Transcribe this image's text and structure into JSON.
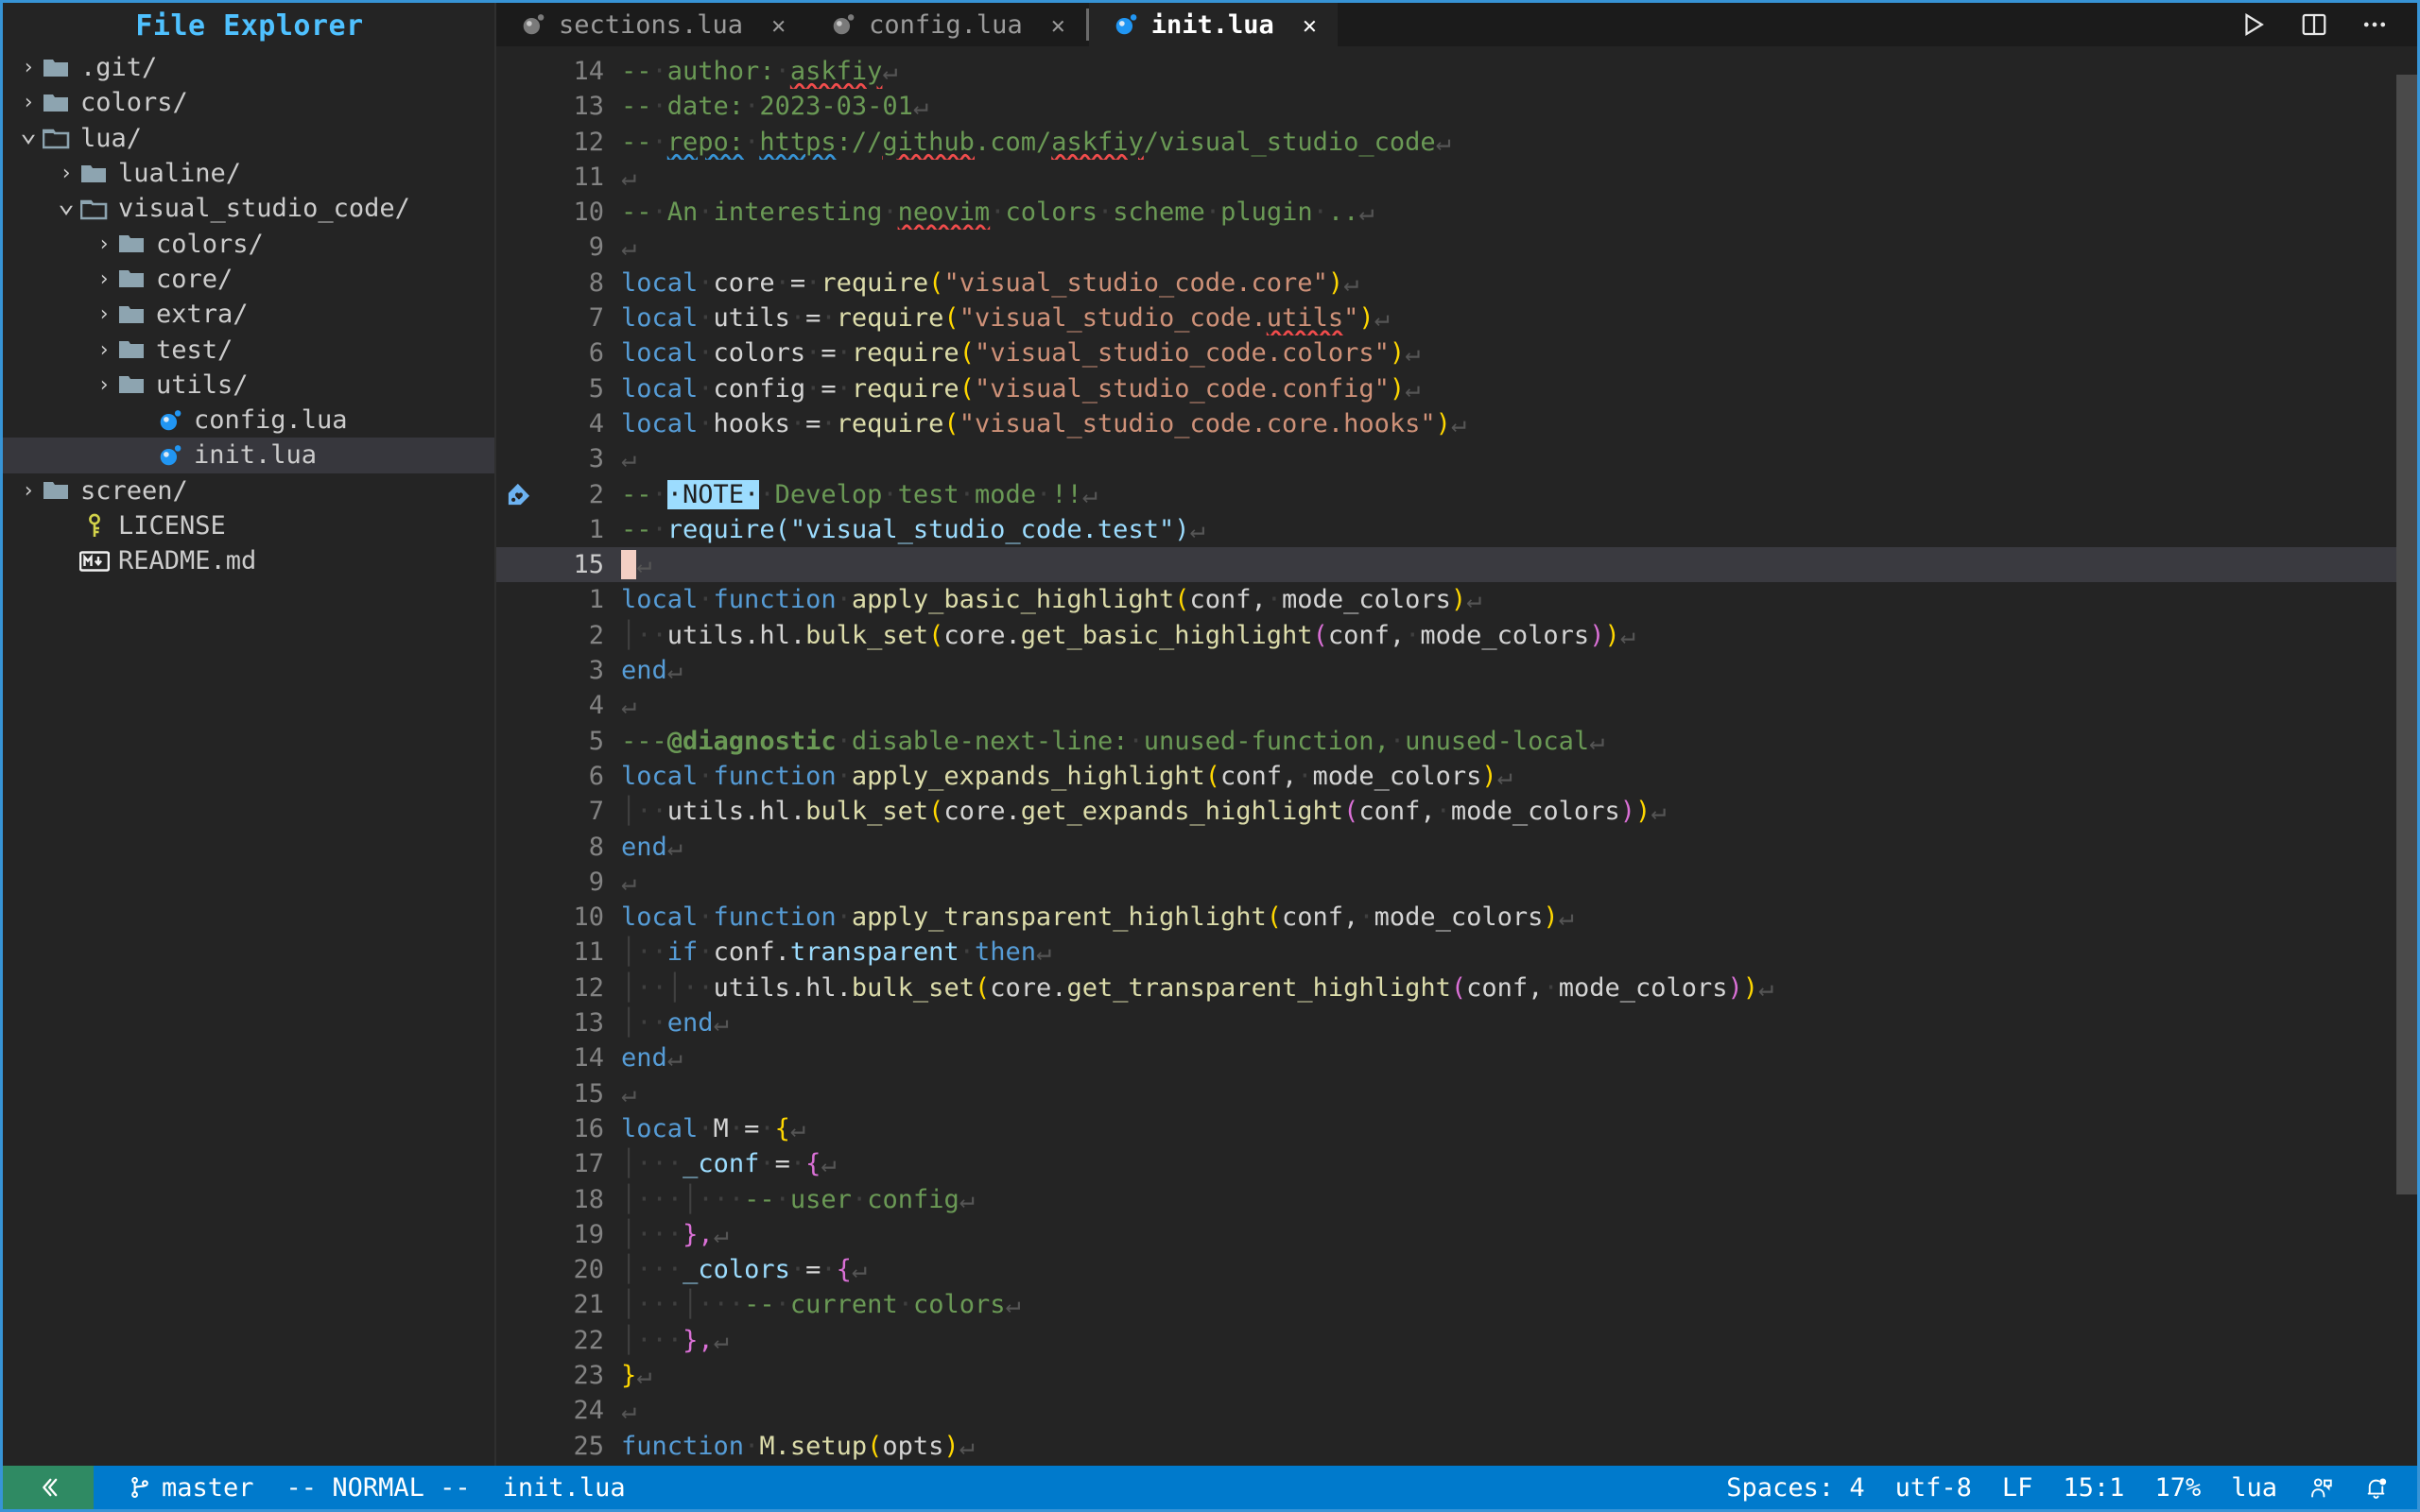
{
  "window": {
    "accent_border": "#3794d6",
    "editor_bg": "#242424",
    "tabbar_bg": "#1b1b1b"
  },
  "sidebar": {
    "title": "File Explorer",
    "items": [
      {
        "label": ".git/",
        "type": "folder",
        "state": "collapsed",
        "depth": 0,
        "icon": "folder-icon",
        "selected": false
      },
      {
        "label": "colors/",
        "type": "folder",
        "state": "collapsed",
        "depth": 0,
        "icon": "folder-icon",
        "selected": false
      },
      {
        "label": "lua/",
        "type": "folder",
        "state": "expanded",
        "depth": 0,
        "icon": "folder-open-icon",
        "selected": false
      },
      {
        "label": "lualine/",
        "type": "folder",
        "state": "collapsed",
        "depth": 1,
        "icon": "folder-icon",
        "selected": false
      },
      {
        "label": "visual_studio_code/",
        "type": "folder",
        "state": "expanded",
        "depth": 1,
        "icon": "folder-open-icon",
        "selected": false
      },
      {
        "label": "colors/",
        "type": "folder",
        "state": "collapsed",
        "depth": 2,
        "icon": "folder-icon",
        "selected": false
      },
      {
        "label": "core/",
        "type": "folder",
        "state": "collapsed",
        "depth": 2,
        "icon": "folder-icon",
        "selected": false
      },
      {
        "label": "extra/",
        "type": "folder",
        "state": "collapsed",
        "depth": 2,
        "icon": "folder-icon",
        "selected": false
      },
      {
        "label": "test/",
        "type": "folder",
        "state": "collapsed",
        "depth": 2,
        "icon": "folder-icon",
        "selected": false
      },
      {
        "label": "utils/",
        "type": "folder",
        "state": "collapsed",
        "depth": 2,
        "icon": "folder-icon",
        "selected": false
      },
      {
        "label": "config.lua",
        "type": "file",
        "state": "none",
        "depth": 3,
        "icon": "lua-file-icon",
        "selected": false
      },
      {
        "label": "init.lua",
        "type": "file",
        "state": "none",
        "depth": 3,
        "icon": "lua-file-icon",
        "selected": true
      },
      {
        "label": "screen/",
        "type": "folder",
        "state": "collapsed",
        "depth": 0,
        "icon": "folder-icon",
        "selected": false
      },
      {
        "label": "LICENSE",
        "type": "file",
        "state": "none",
        "depth": 1,
        "icon": "license-key-icon",
        "selected": false
      },
      {
        "label": "README.md",
        "type": "file",
        "state": "none",
        "depth": 1,
        "icon": "markdown-icon",
        "selected": false
      }
    ]
  },
  "tabs": {
    "items": [
      {
        "label": "sections.lua",
        "icon": "lua-file-icon",
        "close": "✕",
        "active": false
      },
      {
        "label": "config.lua",
        "icon": "lua-file-icon",
        "close": "✕",
        "active": false
      },
      {
        "label": "init.lua",
        "icon": "lua-file-icon",
        "close": "✕",
        "active": true
      }
    ],
    "actions": [
      {
        "name": "run-icon",
        "glyph": "▷"
      },
      {
        "name": "split-editor-icon",
        "glyph": "▫"
      },
      {
        "name": "more-actions-icon",
        "glyph": "⋯"
      }
    ]
  },
  "editor": {
    "filename": "init.lua",
    "language": "lua",
    "cursor_line": 15,
    "lines": [
      {
        "num": "14",
        "type": "rel",
        "sign": null,
        "cursor": false
      },
      {
        "num": "13",
        "type": "rel",
        "sign": null,
        "cursor": false
      },
      {
        "num": "12",
        "type": "rel",
        "sign": null,
        "cursor": false
      },
      {
        "num": "11",
        "type": "rel",
        "sign": null,
        "cursor": false
      },
      {
        "num": "10",
        "type": "rel",
        "sign": null,
        "cursor": false
      },
      {
        "num": "9",
        "type": "rel",
        "sign": null,
        "cursor": false
      },
      {
        "num": "8",
        "type": "rel",
        "sign": null,
        "cursor": false
      },
      {
        "num": "7",
        "type": "rel",
        "sign": null,
        "cursor": false
      },
      {
        "num": "6",
        "type": "rel",
        "sign": null,
        "cursor": false
      },
      {
        "num": "5",
        "type": "rel",
        "sign": null,
        "cursor": false
      },
      {
        "num": "4",
        "type": "rel",
        "sign": null,
        "cursor": false
      },
      {
        "num": "3",
        "type": "rel",
        "sign": null,
        "cursor": false
      },
      {
        "num": "2",
        "type": "rel",
        "sign": "tag-icon",
        "cursor": false
      },
      {
        "num": "1",
        "type": "rel",
        "sign": null,
        "cursor": false
      },
      {
        "num": "15",
        "type": "abs",
        "sign": null,
        "cursor": true
      },
      {
        "num": "1",
        "type": "rel",
        "sign": null,
        "cursor": false
      },
      {
        "num": "2",
        "type": "rel",
        "sign": null,
        "cursor": false
      },
      {
        "num": "3",
        "type": "rel",
        "sign": null,
        "cursor": false
      },
      {
        "num": "4",
        "type": "rel",
        "sign": null,
        "cursor": false
      },
      {
        "num": "5",
        "type": "rel",
        "sign": null,
        "cursor": false
      },
      {
        "num": "6",
        "type": "rel",
        "sign": null,
        "cursor": false
      },
      {
        "num": "7",
        "type": "rel",
        "sign": null,
        "cursor": false
      },
      {
        "num": "8",
        "type": "rel",
        "sign": null,
        "cursor": false
      },
      {
        "num": "9",
        "type": "rel",
        "sign": null,
        "cursor": false
      },
      {
        "num": "10",
        "type": "rel",
        "sign": null,
        "cursor": false
      },
      {
        "num": "11",
        "type": "rel",
        "sign": null,
        "cursor": false
      },
      {
        "num": "12",
        "type": "rel",
        "sign": null,
        "cursor": false
      },
      {
        "num": "13",
        "type": "rel",
        "sign": null,
        "cursor": false
      },
      {
        "num": "14",
        "type": "rel",
        "sign": null,
        "cursor": false
      },
      {
        "num": "15",
        "type": "rel",
        "sign": null,
        "cursor": false
      },
      {
        "num": "16",
        "type": "rel",
        "sign": null,
        "cursor": false
      },
      {
        "num": "17",
        "type": "rel",
        "sign": null,
        "cursor": false
      },
      {
        "num": "18",
        "type": "rel",
        "sign": null,
        "cursor": false
      },
      {
        "num": "19",
        "type": "rel",
        "sign": null,
        "cursor": false
      },
      {
        "num": "20",
        "type": "rel",
        "sign": null,
        "cursor": false
      },
      {
        "num": "21",
        "type": "rel",
        "sign": null,
        "cursor": false
      },
      {
        "num": "22",
        "type": "rel",
        "sign": null,
        "cursor": false
      },
      {
        "num": "23",
        "type": "rel",
        "sign": null,
        "cursor": false
      },
      {
        "num": "24",
        "type": "rel",
        "sign": null,
        "cursor": false
      },
      {
        "num": "25",
        "type": "rel",
        "sign": null,
        "cursor": false
      }
    ],
    "source_text": [
      "-- author: askfiy",
      "-- date: 2023-03-01",
      "-- repo: https://github.com/askfiy/visual_studio_code",
      "",
      "-- An interesting neovim colors scheme plugin ..",
      "",
      "local core = require(\"visual_studio_code.core\")",
      "local utils = require(\"visual_studio_code.utils\")",
      "local colors = require(\"visual_studio_code.colors\")",
      "local config = require(\"visual_studio_code.config\")",
      "local hooks = require(\"visual_studio_code.core.hooks\")",
      "",
      "-- NOTE  Develop test mode !!",
      "-- require(\"visual_studio_code.test\")",
      "",
      "local function apply_basic_highlight(conf, mode_colors)",
      "    utils.hl.bulk_set(core.get_basic_highlight(conf, mode_colors))",
      "end",
      "",
      "---@diagnostic disable-next-line: unused-function, unused-local",
      "local function apply_expands_highlight(conf, mode_colors)",
      "    utils.hl.bulk_set(core.get_expands_highlight(conf, mode_colors))",
      "end",
      "",
      "local function apply_transparent_highlight(conf, mode_colors)",
      "    if conf.transparent then",
      "        utils.hl.bulk_set(core.get_transparent_highlight(conf, mode_colors))",
      "    end",
      "end",
      "",
      "local M = {",
      "    _conf = {",
      "        -- user config",
      "    },",
      "    _colors = {",
      "        -- current colors",
      "    },",
      "}",
      "",
      "function M.setup(opts)"
    ]
  },
  "statusbar": {
    "remote_icon": "remote-window-icon",
    "branch_icon": "git-branch-icon",
    "branch": "master",
    "mode": "-- NORMAL --",
    "filename": "init.lua",
    "indentation": "Spaces: 4",
    "encoding": "utf-8",
    "eol": "LF",
    "position": "15:1",
    "zoom": "17%",
    "language": "lua",
    "feedback_icon": "feedback-smiley-icon",
    "bell_icon": "notifications-bell-dot-icon",
    "accent": "#007acc",
    "remote_bg": "#2f8a63"
  }
}
